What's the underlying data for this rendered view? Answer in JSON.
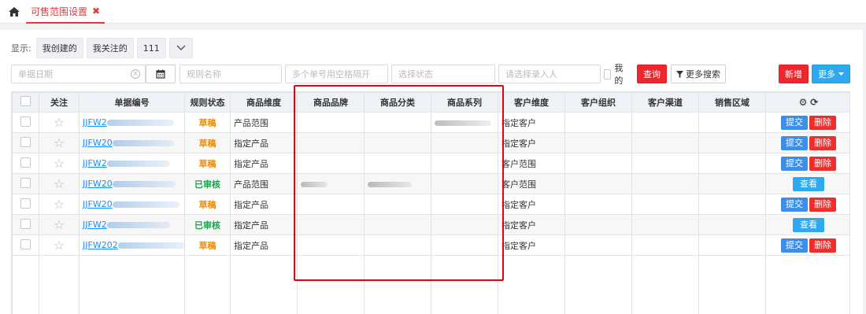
{
  "topbar": {
    "tab_label": "可售范围设置",
    "close_glyph": "✖"
  },
  "display": {
    "label": "显示:",
    "options": [
      "我创建的",
      "我关注的",
      "111"
    ],
    "caret": "﹀"
  },
  "filters": {
    "date_placeholder": "单据日期",
    "rule_name_placeholder": "规则名称",
    "codes_placeholder": "多个单号用空格隔开",
    "status_placeholder": "选择状态",
    "entry_person_placeholder": "请选择录入人",
    "mine_label": "我的",
    "query_label": "查询",
    "more_search_label": "更多搜索",
    "new_label": "新增",
    "more_label": "更多"
  },
  "table": {
    "columns": [
      "关注",
      "单据编号",
      "规则状态",
      "商品维度",
      "商品品牌",
      "商品分类",
      "商品系列",
      "客户维度",
      "客户组织",
      "客户渠道",
      "销售区域"
    ],
    "rows": [
      {
        "code": "JJFW2",
        "status": "草稿",
        "status_type": "draft",
        "goods_dim": "产品范围",
        "brand": "",
        "category": "",
        "series": "blur",
        "cust_dim": "指定客户",
        "actions": [
          "提交",
          "删除"
        ]
      },
      {
        "code": "JJFW20",
        "status": "草稿",
        "status_type": "draft",
        "goods_dim": "指定产品",
        "brand": "",
        "category": "",
        "series": "",
        "cust_dim": "指定客户",
        "actions": [
          "提交",
          "删除"
        ]
      },
      {
        "code": "JJFW2",
        "status": "草稿",
        "status_type": "draft",
        "goods_dim": "指定产品",
        "brand": "",
        "category": "",
        "series": "",
        "cust_dim": "客户范围",
        "actions": [
          "提交",
          "删除"
        ]
      },
      {
        "code": "JJFW20",
        "status": "已审核",
        "status_type": "approved",
        "goods_dim": "产品范围",
        "brand": "blur",
        "category": "blur",
        "series": "",
        "cust_dim": "客户范围",
        "actions": [
          "查看"
        ]
      },
      {
        "code": "JJFW20",
        "status": "草稿",
        "status_type": "draft",
        "goods_dim": "指定产品",
        "brand": "",
        "category": "",
        "series": "",
        "cust_dim": "指定客户",
        "actions": [
          "提交",
          "删除"
        ]
      },
      {
        "code": "JJFW2",
        "status": "已审核",
        "status_type": "approved",
        "goods_dim": "指定产品",
        "brand": "",
        "category": "",
        "series": "",
        "cust_dim": "指定客户",
        "actions": [
          "查看"
        ]
      },
      {
        "code": "JJFW202",
        "status": "草稿",
        "status_type": "draft",
        "goods_dim": "指定产品",
        "brand": "",
        "category": "",
        "series": "",
        "cust_dim": "指定客户",
        "actions": [
          "提交",
          "删除"
        ]
      }
    ]
  },
  "colors": {
    "accent_red": "#e4393c",
    "link_blue": "#1890ff",
    "draft_orange": "#f08c00",
    "approved_green": "#19a34a",
    "highlight_red": "#e60012"
  }
}
